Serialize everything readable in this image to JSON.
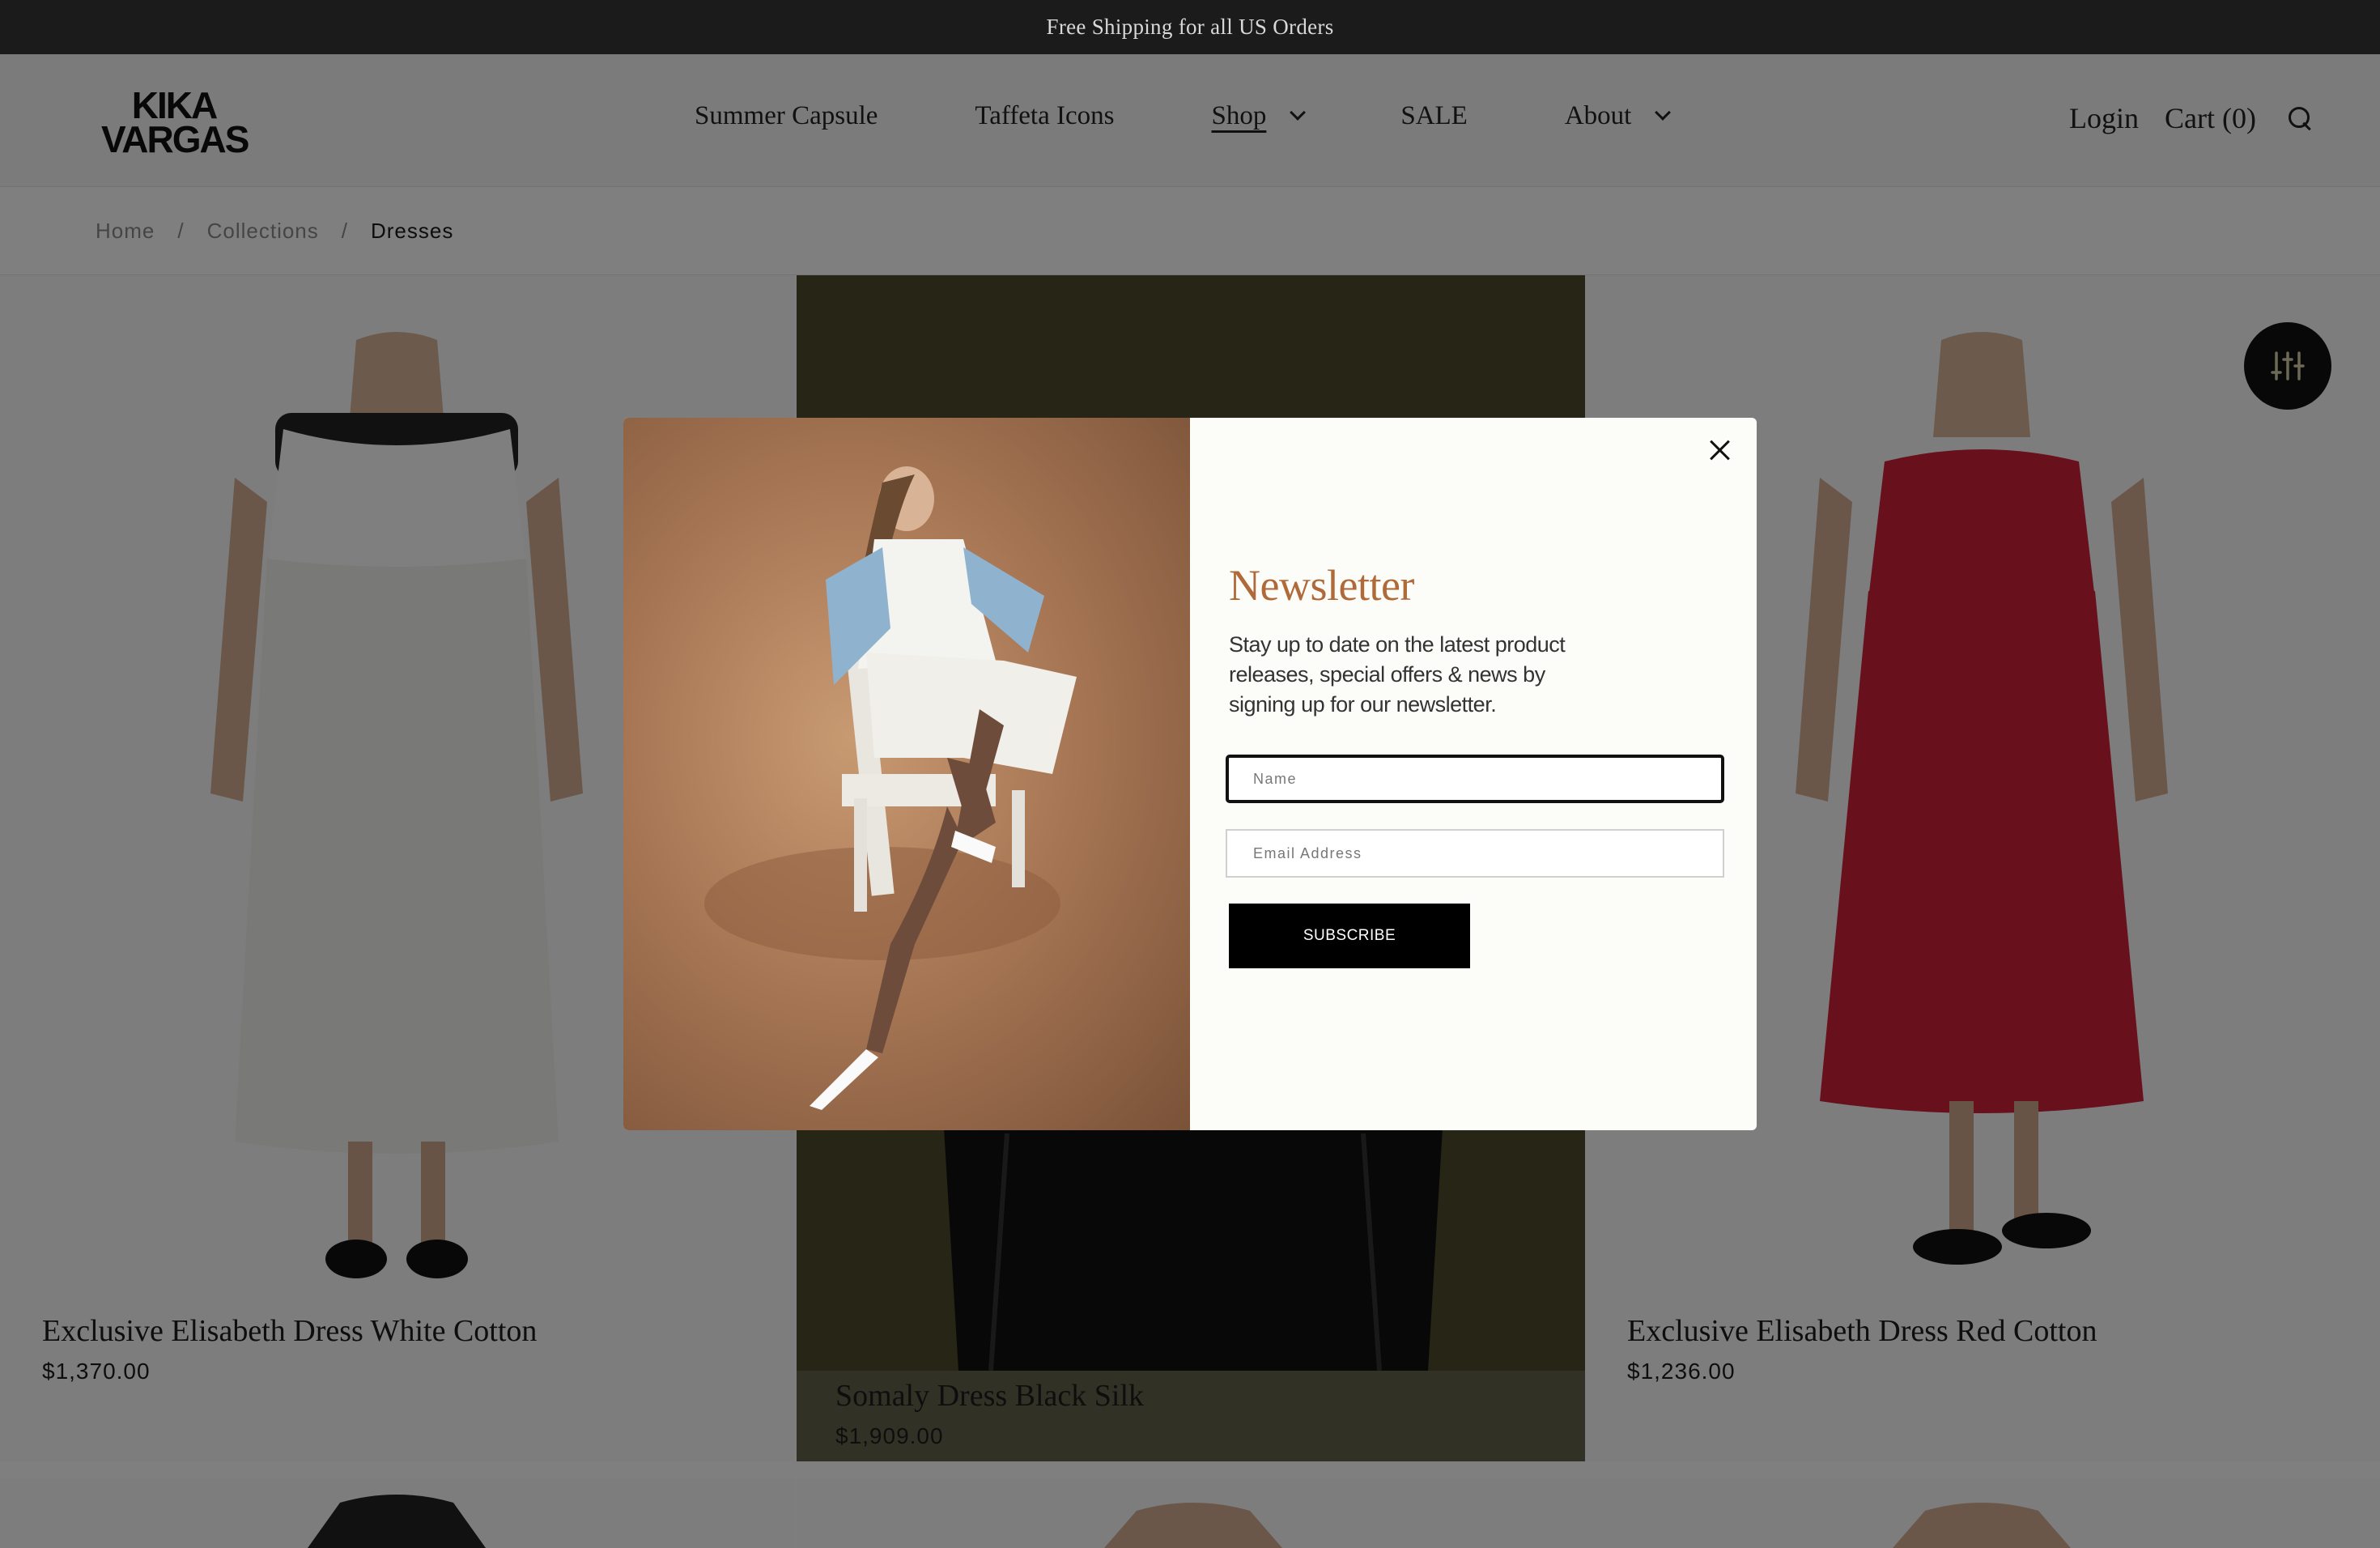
{
  "announcement": "Free Shipping for all US Orders",
  "brand": {
    "logo_line1": "KIKA",
    "logo_line2": "VARGAS"
  },
  "nav": [
    {
      "label": "Summer Capsule",
      "dropdown": false
    },
    {
      "label": "Taffeta Icons",
      "dropdown": false
    },
    {
      "label": "Shop",
      "dropdown": true,
      "active": true
    },
    {
      "label": "SALE",
      "dropdown": false
    },
    {
      "label": "About",
      "dropdown": true
    }
  ],
  "header_right": {
    "login": "Login",
    "cart": "Cart (0)",
    "search_icon": "search-icon"
  },
  "breadcrumb": {
    "home": "Home",
    "sep": "/",
    "collections": "Collections",
    "current": "Dresses"
  },
  "products": [
    {
      "name": "Exclusive Elisabeth Dress White Cotton",
      "price": "$1,370.00",
      "dress_color": "#f2f2ef"
    },
    {
      "name": "Somaly Dress Black Silk",
      "price": "$1,909.00",
      "dress_color": "#111111"
    },
    {
      "name": "Exclusive Elisabeth Dress Red Cotton",
      "price": "$1,236.00",
      "dress_color": "#d3203a"
    }
  ],
  "filter_icon": "sliders-icon",
  "newsletter": {
    "title": "Newsletter",
    "description": "Stay up to date on the latest product releases, special offers & news by signing up for our newsletter.",
    "name_placeholder": "Name",
    "email_placeholder": "Email Address",
    "subscribe_label": "SUBSCRIBE",
    "close_icon": "close-icon"
  },
  "colors": {
    "announcement_bg": "#1b1b1b",
    "accent_title": "#b06a3a",
    "button_bg": "#000000",
    "overlay": "rgba(0,0,0,0.5)"
  }
}
